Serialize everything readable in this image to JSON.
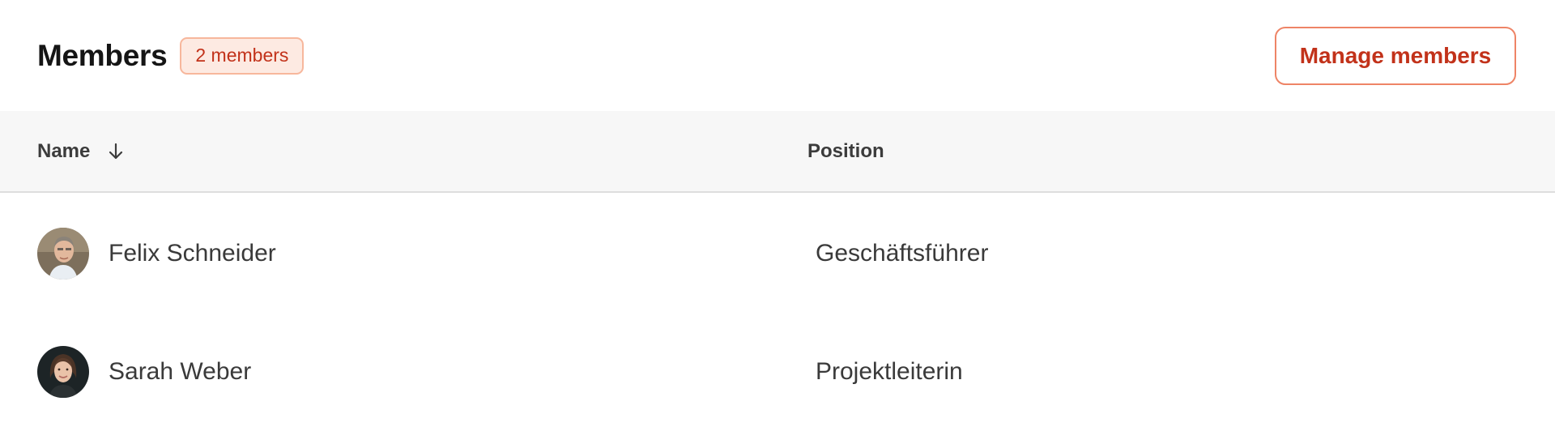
{
  "header": {
    "title": "Members",
    "badge": "2 members",
    "manage_button": "Manage members"
  },
  "table": {
    "columns": [
      {
        "label": "Name",
        "sort": "descending",
        "sort_icon": "arrow-down-icon"
      },
      {
        "label": "Position"
      }
    ],
    "rows": [
      {
        "name": "Felix Schneider",
        "position": "Geschäftsführer",
        "avatar": "avatar-photo-man"
      },
      {
        "name": "Sarah Weber",
        "position": "Projektleiterin",
        "avatar": "avatar-photo-woman"
      }
    ]
  },
  "colors": {
    "accent": "#c2321a",
    "badge_bg": "#fdeae2",
    "badge_border": "#f7b79c",
    "button_border": "#ee8466",
    "header_bg": "#f7f7f7",
    "text": "#3a3a3a"
  }
}
